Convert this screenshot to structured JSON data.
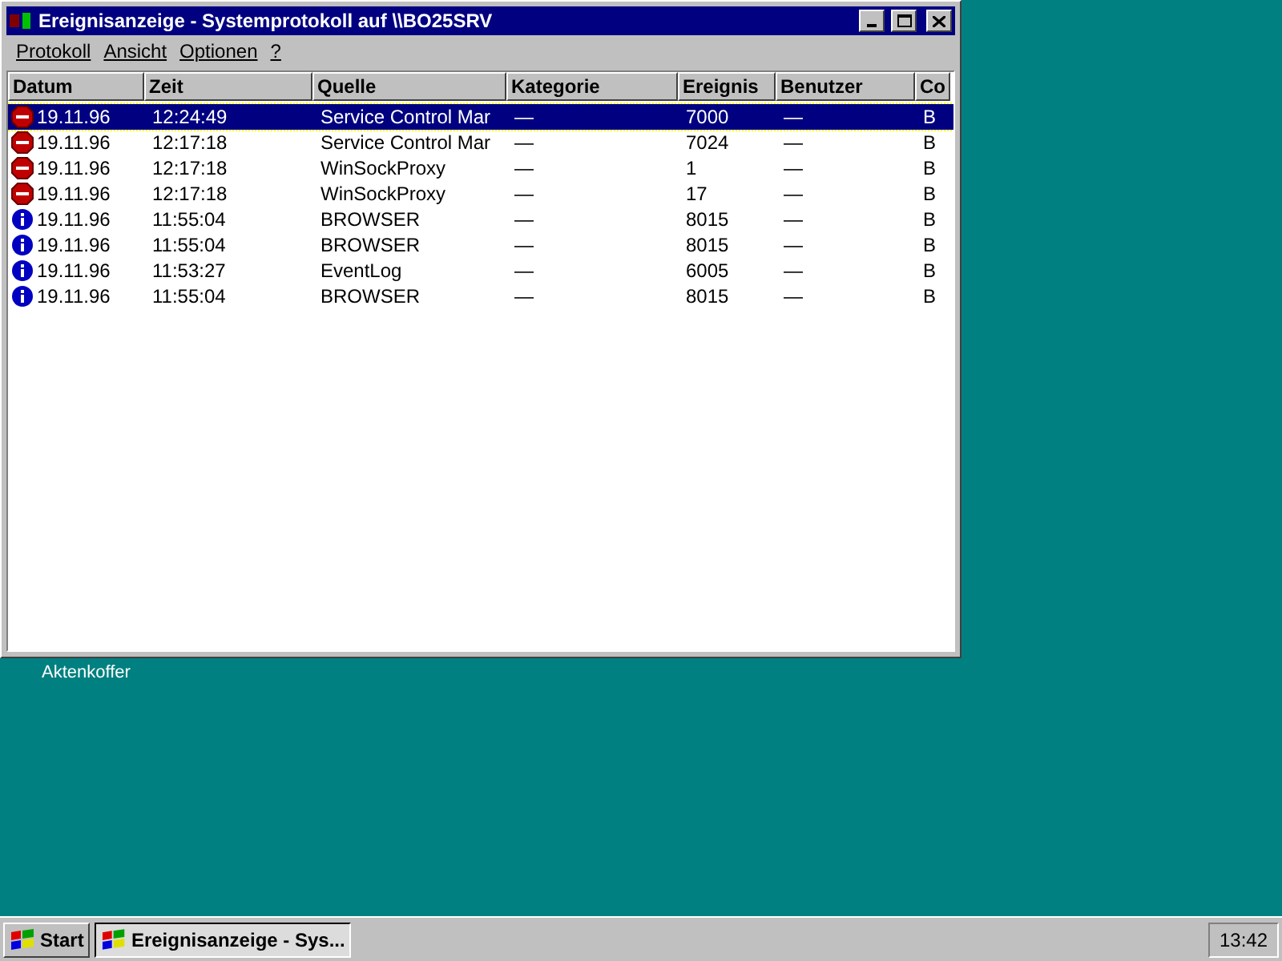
{
  "window": {
    "title": "Ereignisanzeige - Systemprotokoll auf \\\\BO25SRV"
  },
  "menu": [
    "Protokoll",
    "Ansicht",
    "Optionen",
    "?"
  ],
  "table": {
    "columns": [
      "Datum",
      "Zeit",
      "Quelle",
      "Kategorie",
      "Ereignis",
      "Benutzer",
      "Co"
    ],
    "rows": [
      {
        "kind": "error",
        "selected": true,
        "cells": [
          "19.11.96",
          "12:24:49",
          "Service Control Mar",
          "—",
          "7000",
          "—",
          "B"
        ]
      },
      {
        "kind": "error",
        "selected": false,
        "cells": [
          "19.11.96",
          "12:17:18",
          "Service Control Mar",
          "—",
          "7024",
          "—",
          "B"
        ]
      },
      {
        "kind": "error",
        "selected": false,
        "cells": [
          "19.11.96",
          "12:17:18",
          "WinSockProxy",
          "—",
          "1",
          "—",
          "B"
        ]
      },
      {
        "kind": "error",
        "selected": false,
        "cells": [
          "19.11.96",
          "12:17:18",
          "WinSockProxy",
          "—",
          "17",
          "—",
          "B"
        ]
      },
      {
        "kind": "info",
        "selected": false,
        "cells": [
          "19.11.96",
          "11:55:04",
          "BROWSER",
          "—",
          "8015",
          "—",
          "B"
        ]
      },
      {
        "kind": "info",
        "selected": false,
        "cells": [
          "19.11.96",
          "11:55:04",
          "BROWSER",
          "—",
          "8015",
          "—",
          "B"
        ]
      },
      {
        "kind": "info",
        "selected": false,
        "cells": [
          "19.11.96",
          "11:53:27",
          "EventLog",
          "—",
          "6005",
          "—",
          "B"
        ]
      },
      {
        "kind": "info",
        "selected": false,
        "cells": [
          "19.11.96",
          "11:55:04",
          "BROWSER",
          "—",
          "8015",
          "—",
          "B"
        ]
      }
    ]
  },
  "desktop_icons": [
    {
      "label": "Aktenkoffer"
    }
  ],
  "taskbar": {
    "start": "Start",
    "tasks": [
      {
        "label": "Ereignisanzeige - Sys...",
        "selected": true
      }
    ],
    "clock": "13:42"
  }
}
